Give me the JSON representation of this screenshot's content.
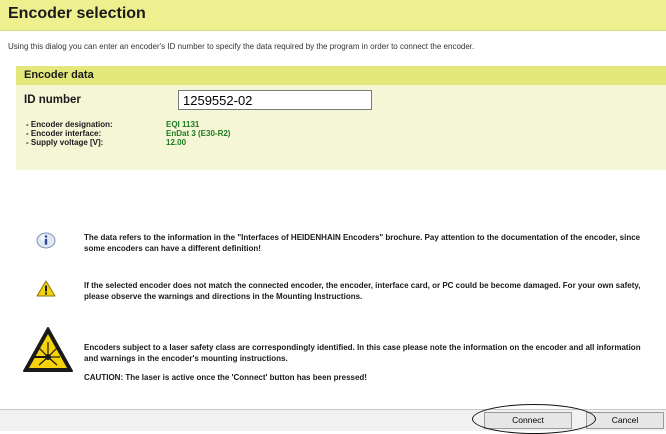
{
  "dialog": {
    "title": "Encoder selection",
    "intro": "Using this dialog you can enter an encoder's ID number to specify the data required by the program in order to connect the encoder."
  },
  "encoder_data": {
    "header": "Encoder data",
    "id_label": "ID number",
    "id_value": "1259552-02",
    "rows": [
      {
        "label": "- Encoder designation:",
        "value": "EQI 1131"
      },
      {
        "label": "- Encoder interface:",
        "value": "EnDat 3 (E30-R2)"
      },
      {
        "label": "- Supply voltage [V]:",
        "value": "12.00"
      }
    ]
  },
  "notes": {
    "info": "The data refers to the information in the \"Interfaces of HEIDENHAIN Encoders\" brochure. Pay attention to the documentation of the encoder, since some encoders can have a different definition!",
    "warning": "If the selected encoder does not match the connected encoder, the encoder, interface card, or PC could be become damaged. For your own safety, please observe the warnings and directions in the Mounting Instructions.",
    "laser": "Encoders subject to a laser safety class are correspondingly identified. In this case please note the information on the encoder and all information and warnings in the encoder's mounting instructions.",
    "laser_caution": "CAUTION: The laser is active once the 'Connect' button has been pressed!"
  },
  "buttons": {
    "connect": "Connect",
    "cancel": "Cancel"
  },
  "icons": {
    "info": "info-icon",
    "warning": "warning-icon",
    "laser": "laser-warning-icon"
  },
  "colors": {
    "title_bar": "#eef08f",
    "panel_header": "#e4e87a",
    "panel_bg": "#f4f6d6",
    "value_text": "#1e7a1e",
    "warning_yellow": "#f6d20a"
  }
}
